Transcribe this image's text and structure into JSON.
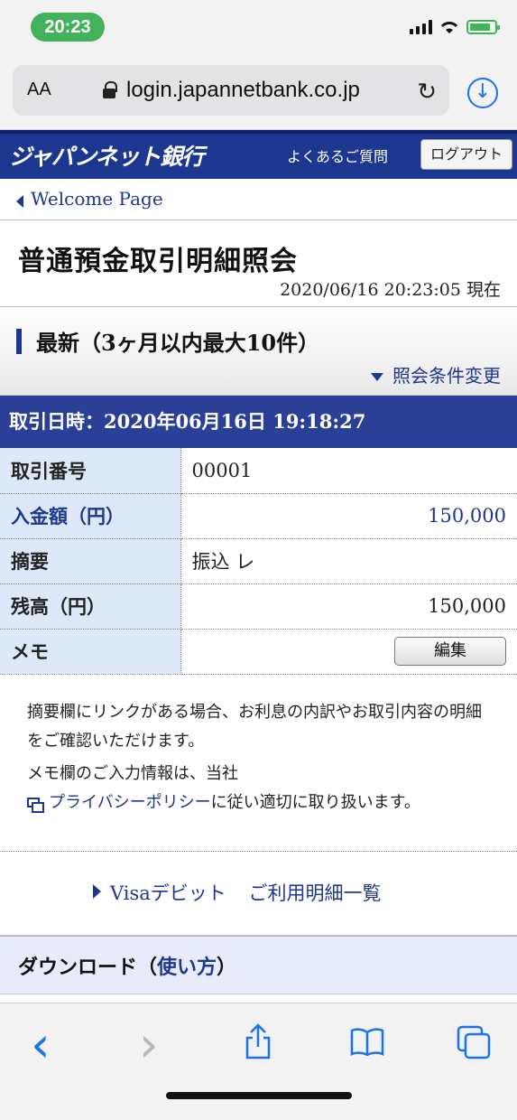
{
  "status": {
    "time": "20:23"
  },
  "browser": {
    "aa_label": "AA",
    "url": "login.japannetbank.co.jp",
    "reload_icon": "reload-icon",
    "download_icon": "download-icon"
  },
  "bank": {
    "name": "ジャパンネット銀行",
    "faq": "よくあるご質問",
    "logout": "ログアウト"
  },
  "nav": {
    "welcome": "Welcome Page"
  },
  "page": {
    "title": "普通預金取引明細照会",
    "as_of": "2020/06/16 20:23:05 現在"
  },
  "section": {
    "title": "最新（3ヶ月以内最大10件）",
    "change_conditions": "照会条件変更"
  },
  "transaction": {
    "datetime_header": "取引日時：2020年06月16日 19:18:27",
    "rows": [
      {
        "label": "取引番号",
        "value": "00001"
      },
      {
        "label": "入金額（円）",
        "value": "150,000"
      },
      {
        "label": "摘要",
        "value": "振込 レ"
      },
      {
        "label": "残高（円）",
        "value": "150,000"
      },
      {
        "label": "メモ",
        "value": ""
      }
    ],
    "edit_button": "編集"
  },
  "notes": {
    "line1": "摘要欄にリンクがある場合、お利息の内訳やお取引内容の明細をご確認いただけます。",
    "line2": "メモ欄のご入力情報は、当社",
    "privacy_link": "プライバシーポリシー",
    "line3": "に従い適切に取り扱います。"
  },
  "visa": {
    "link": "Visaデビット ご利用明細一覧"
  },
  "download": {
    "label": "ダウンロード（",
    "howto": "使い方",
    "close": "）"
  },
  "toolbar": {
    "back": "‹",
    "forward": "›",
    "share_icon": "share-icon",
    "bookmarks_icon": "bookmarks-icon",
    "tabs_icon": "tabs-icon"
  },
  "colors": {
    "brand": "#1d3690",
    "label_bg": "#dde9f9",
    "ios_blue": "#1a73e8",
    "status_green": "#43b35b"
  }
}
